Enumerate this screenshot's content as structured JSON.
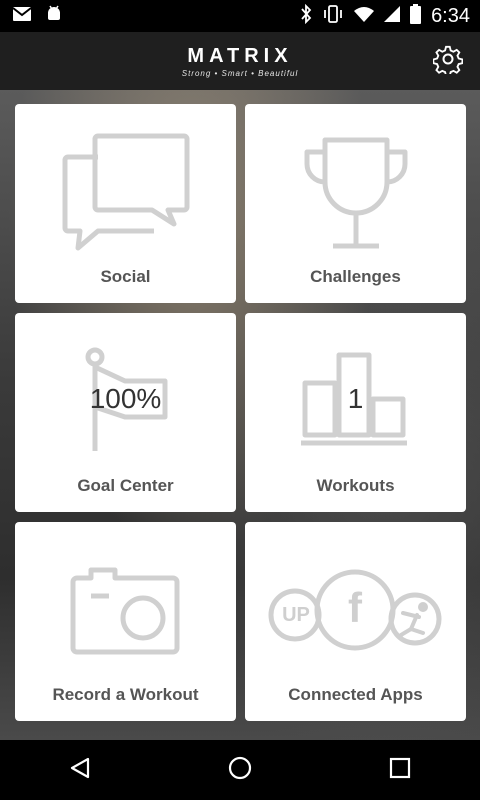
{
  "status_bar": {
    "time": "6:34",
    "left_icons": [
      "mail-icon",
      "android-debug-icon"
    ],
    "right_icons": [
      "bluetooth-icon",
      "vibrate-icon",
      "wifi-icon",
      "cell-signal-icon",
      "battery-icon"
    ]
  },
  "header": {
    "brand_name": "MATRIX",
    "tagline": "Strong • Smart • Beautiful",
    "settings_icon": "gear-icon"
  },
  "tiles": [
    {
      "label": "Social",
      "icon": "chat-bubbles-icon"
    },
    {
      "label": "Challenges",
      "icon": "trophy-icon"
    },
    {
      "label": "Goal Center",
      "icon": "flag-icon",
      "value": "100%"
    },
    {
      "label": "Workouts",
      "icon": "podium-icon",
      "value": "1"
    },
    {
      "label": "Record a Workout",
      "icon": "camera-icon"
    },
    {
      "label": "Connected Apps",
      "icon": "connected-apps-icon",
      "badges": [
        "UP",
        "f"
      ]
    }
  ],
  "nav": [
    "back-icon",
    "home-icon",
    "recents-icon"
  ],
  "colors": {
    "tile_bg": "#ffffff",
    "tile_label": "#555555",
    "icon_stroke": "#d0d0d0",
    "header_bg": "#1f1f1f"
  }
}
